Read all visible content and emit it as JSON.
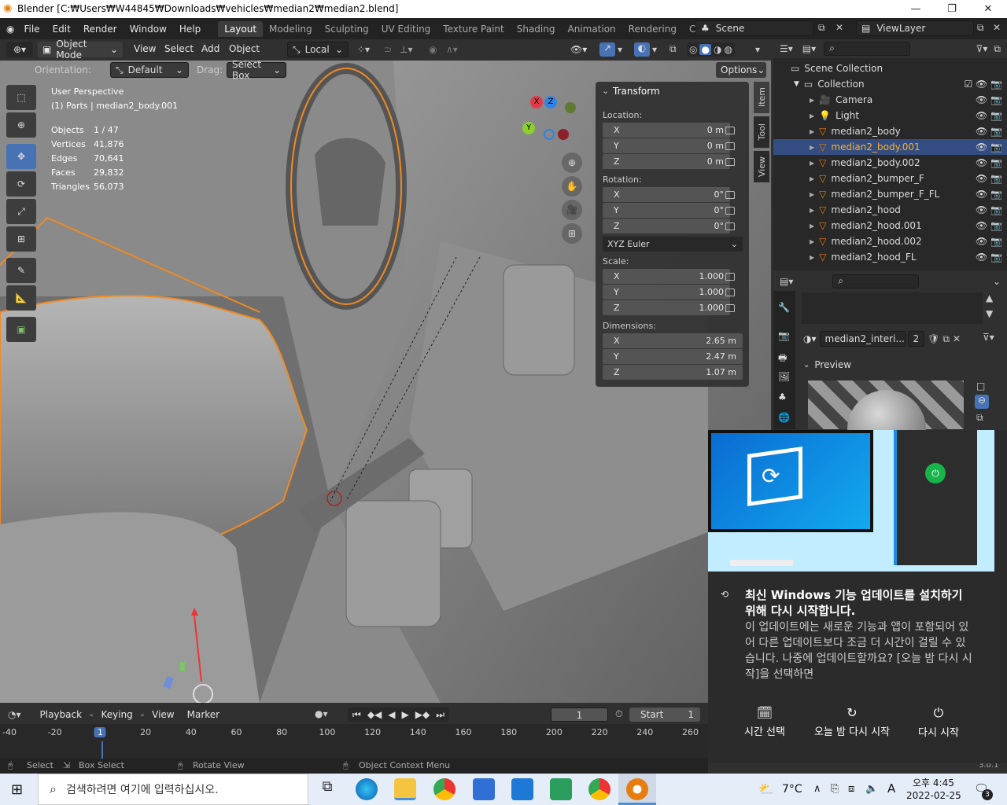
{
  "title_bar": {
    "title": "Blender [C:₩Users₩W44845₩Downloads₩vehicles₩median2₩median2.blend]",
    "min": "—",
    "max": "❐",
    "close": "✕"
  },
  "menu": {
    "items": [
      "File",
      "Edit",
      "Render",
      "Window",
      "Help"
    ],
    "workspaces": [
      "Layout",
      "Modeling",
      "Sculpting",
      "UV Editing",
      "Texture Paint",
      "Shading",
      "Animation",
      "Rendering",
      "Compositing"
    ],
    "scene": "Scene",
    "view_layer": "ViewLayer"
  },
  "header": {
    "mode": "Object Mode",
    "view": "View",
    "select": "Select",
    "add": "Add",
    "object": "Object",
    "transform": "Local"
  },
  "tool_settings": {
    "orientation_label": "Orientation:",
    "orientation": "Default",
    "drag_label": "Drag:",
    "drag": "Select Box",
    "options": "Options"
  },
  "overlay_stats": {
    "perspective": "User Perspective",
    "context": "(1) Parts | median2_body.001",
    "rows": [
      [
        "Objects",
        "1 / 47"
      ],
      [
        "Vertices",
        "41,876"
      ],
      [
        "Edges",
        "70,641"
      ],
      [
        "Faces",
        "29,832"
      ],
      [
        "Triangles",
        "56,073"
      ]
    ]
  },
  "gizmo": {
    "x": "X",
    "y": "Y",
    "z": "Z"
  },
  "n_panel": {
    "title": "Transform",
    "location_label": "Location:",
    "location": [
      [
        "X",
        "0 m"
      ],
      [
        "Y",
        "0 m"
      ],
      [
        "Z",
        "0 m"
      ]
    ],
    "rotation_label": "Rotation:",
    "rotation": [
      [
        "X",
        "0°"
      ],
      [
        "Y",
        "0°"
      ],
      [
        "Z",
        "0°"
      ]
    ],
    "rotation_mode": "XYZ Euler",
    "scale_label": "Scale:",
    "scale": [
      [
        "X",
        "1.000"
      ],
      [
        "Y",
        "1.000"
      ],
      [
        "Z",
        "1.000"
      ]
    ],
    "dimensions_label": "Dimensions:",
    "dimensions": [
      [
        "X",
        "2.65 m"
      ],
      [
        "Y",
        "2.47 m"
      ],
      [
        "Z",
        "1.07 m"
      ]
    ],
    "tabs": [
      "Item",
      "Tool",
      "View"
    ]
  },
  "outliner": {
    "root": "Scene Collection",
    "collection": "Collection",
    "items": [
      "Camera",
      "Light",
      "median2_body",
      "median2_body.001",
      "median2_body.002",
      "median2_bumper_F",
      "median2_bumper_F_FL",
      "median2_hood",
      "median2_hood.001",
      "median2_hood.002",
      "median2_hood_FL"
    ],
    "selected_index": 3
  },
  "properties": {
    "material_name": "median2_interi...",
    "user_count": "2",
    "preview_label": "Preview"
  },
  "timeline": {
    "menus": [
      "Playback",
      "Keying",
      "View",
      "Marker"
    ],
    "current_frame": "1",
    "start_label": "Start",
    "start": "1",
    "ruler": [
      "-40",
      "-20",
      "1",
      "20",
      "40",
      "60",
      "80",
      "100",
      "120",
      "140",
      "160",
      "180",
      "200",
      "220",
      "240",
      "260"
    ]
  },
  "status_bar": {
    "select": "Select",
    "box_select": "Box Select",
    "rotate_view": "Rotate View",
    "context_menu": "Object Context Menu",
    "version": "3.0.1"
  },
  "toast": {
    "heading": "최신 Windows 기능 업데이트를 설치하기 위해 다시 시작합니다.",
    "body": "이 업데이트에는 새로운 기능과 앱이 포함되어 있어 다른 업데이트보다 조금 더 시간이 걸릴 수 있습니다. 나중에 업데이트할까요? [오늘 밤 다시 시작]을 선택하면",
    "actions": [
      "시간 선택",
      "오늘 밤 다시 시작",
      "다시 시작"
    ]
  },
  "taskbar": {
    "search_placeholder": "검색하려면 여기에 입력하십시오.",
    "weather": "7°C",
    "ime": "A",
    "time": "오후 4:45",
    "date": "2022-02-25",
    "notifications": "3"
  }
}
